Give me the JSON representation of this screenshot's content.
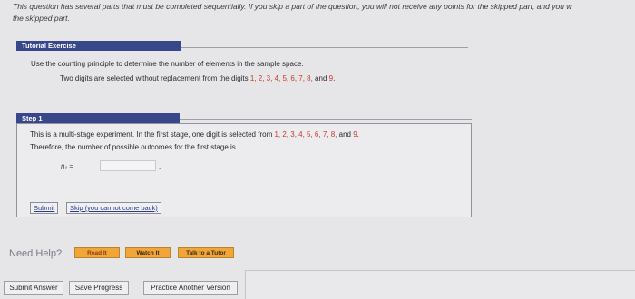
{
  "intro": {
    "line1": "This question has several parts that must be completed sequentially. If you skip a part of the question, you will not receive any points for the skipped part, and you w",
    "line2": "the skipped part."
  },
  "tutorial": {
    "heading": "Tutorial Exercise",
    "instruction": "Use the counting principle to determine the number of elements in the sample space.",
    "problem_prefix": "Two digits are selected without replacement from the digits ",
    "digits": "1, 2, 3, 4, 5, 6, 7, 8,",
    "and": " and ",
    "last_digit": "9",
    "period": "."
  },
  "step": {
    "heading": "Step 1",
    "line1_prefix": "This is a multi-stage experiment. In the first stage, one digit is selected from ",
    "digits": "1, 2, 3, 4, 5, 6, 7, 8,",
    "and": " and ",
    "last_digit": "9",
    "period": ".",
    "line2": "Therefore, the number of possible outcomes for the first stage is",
    "n1_label": "n₁ =",
    "n1_value": "",
    "n1_suffix": ".",
    "submit_label": "Submit",
    "skip_label": "Skip (you cannot come back)"
  },
  "help": {
    "label": "Need Help?",
    "read_it": "Read It",
    "watch_it": "Watch It",
    "talk_to_tutor": "Talk to a Tutor"
  },
  "footer": {
    "submit_answer": "Submit Answer",
    "save_progress": "Save Progress",
    "practice_another": "Practice Another Version"
  },
  "colors": {
    "section_header_bg": "#38468a",
    "digit_red": "#c43a2a",
    "help_button_orange": "#f2a63a"
  }
}
